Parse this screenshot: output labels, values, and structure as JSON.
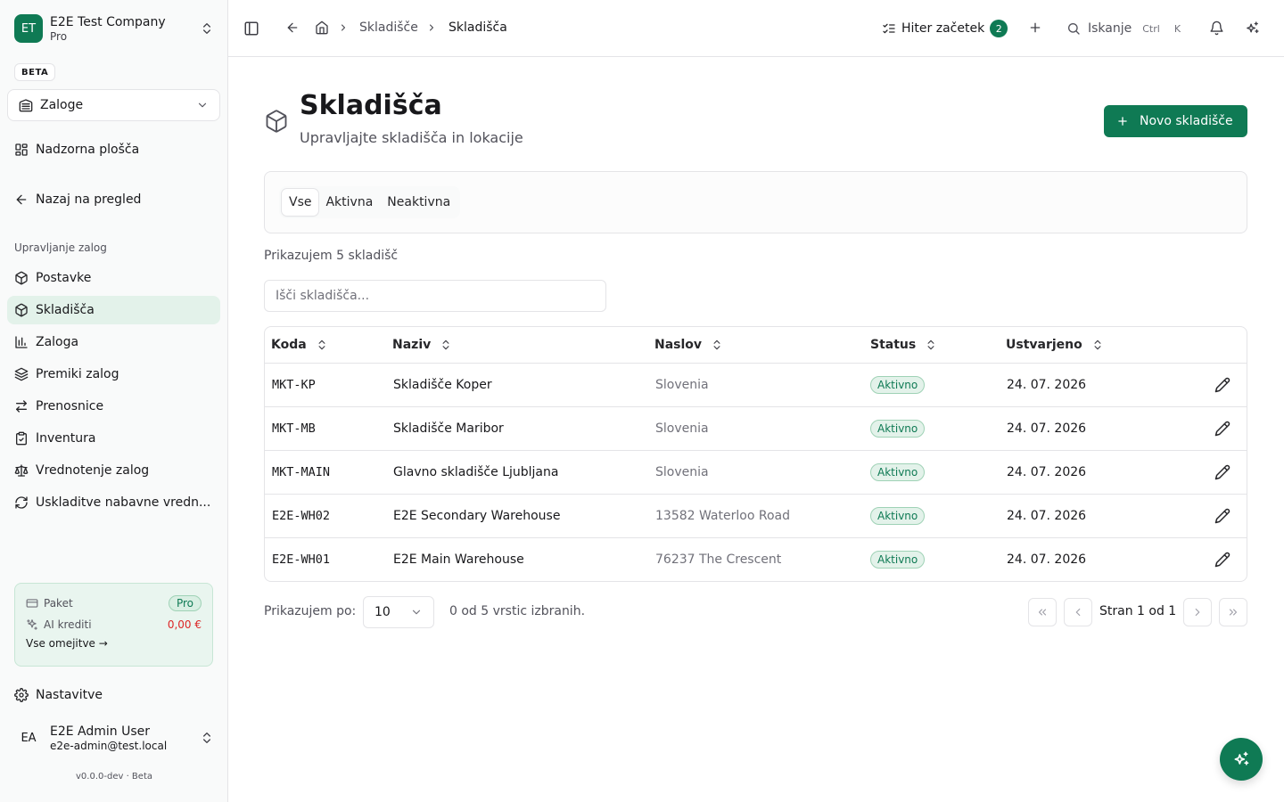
{
  "company": {
    "initials": "ET",
    "name": "E2E Test Company",
    "plan": "Pro"
  },
  "beta_label": "BETA",
  "module": {
    "selected": "Zaloge"
  },
  "sidebar": {
    "dashboard": "Nadzorna plošča",
    "back": "Nazaj na pregled",
    "section_label": "Upravljanje zalog",
    "items": [
      {
        "label": "Postavke",
        "icon": "package-icon"
      },
      {
        "label": "Skladišča",
        "icon": "package-icon",
        "active": true
      },
      {
        "label": "Zaloga",
        "icon": "bar-chart-icon"
      },
      {
        "label": "Premiki zalog",
        "icon": "layers-icon"
      },
      {
        "label": "Prenosnice",
        "icon": "arrows-swap-icon"
      },
      {
        "label": "Inventura",
        "icon": "clipboard-check-icon"
      },
      {
        "label": "Vrednotenje zalog",
        "icon": "scale-icon"
      },
      {
        "label": "Uskladitve nabavne vredn...",
        "icon": "refresh-icon"
      }
    ],
    "settings": "Nastavitve"
  },
  "plan_card": {
    "plan_label": "Paket",
    "plan_value": "Pro",
    "credits_label": "AI krediti",
    "credits_value": "0,00 €",
    "limits_link": "Vse omejitve →"
  },
  "user": {
    "initials": "EA",
    "name": "E2E Admin User",
    "email": "e2e-admin@test.local"
  },
  "version": "v0.0.0-dev · Beta",
  "header": {
    "breadcrumb": [
      "Skladišče",
      "Skladišča"
    ],
    "quickstart_label": "Hiter začetek",
    "quickstart_count": "2",
    "search_label": "Iskanje",
    "kbd_ctrl": "Ctrl",
    "kbd_k": "K"
  },
  "page": {
    "title": "Skladišča",
    "subtitle": "Upravljajte skladišča in lokacije",
    "new_button": "Novo skladišče"
  },
  "filters": {
    "tabs": [
      "Vse",
      "Aktivna",
      "Neaktivna"
    ],
    "active_tab": 0
  },
  "count_text": "Prikazujem 5 skladišč",
  "search": {
    "placeholder": "Išči skladišča...",
    "value": ""
  },
  "table": {
    "columns": [
      "Koda",
      "Naziv",
      "Naslov",
      "Status",
      "Ustvarjeno"
    ],
    "rows": [
      {
        "code": "MKT-KP",
        "name": "Skladišče Koper",
        "address": "Slovenia",
        "status": "Aktivno",
        "created": "24. 07. 2026"
      },
      {
        "code": "MKT-MB",
        "name": "Skladišče Maribor",
        "address": "Slovenia",
        "status": "Aktivno",
        "created": "24. 07. 2026"
      },
      {
        "code": "MKT-MAIN",
        "name": "Glavno skladišče Ljubljana",
        "address": "Slovenia",
        "status": "Aktivno",
        "created": "24. 07. 2026"
      },
      {
        "code": "E2E-WH02",
        "name": "E2E Secondary Warehouse",
        "address": "13582 Waterloo Road",
        "status": "Aktivno",
        "created": "24. 07. 2026"
      },
      {
        "code": "E2E-WH01",
        "name": "E2E Main Warehouse",
        "address": "76237 The Crescent",
        "status": "Aktivno",
        "created": "24. 07. 2026"
      }
    ]
  },
  "pagination": {
    "per_page_label": "Prikazujem po:",
    "per_page": "10",
    "selected_text": "0 od 5 vrstic izbranih.",
    "page_info": "Stran 1 od 1"
  },
  "colors": {
    "brand": "#0f7a54",
    "active_nav": "#e3f2ea",
    "danger": "#dc2626"
  }
}
